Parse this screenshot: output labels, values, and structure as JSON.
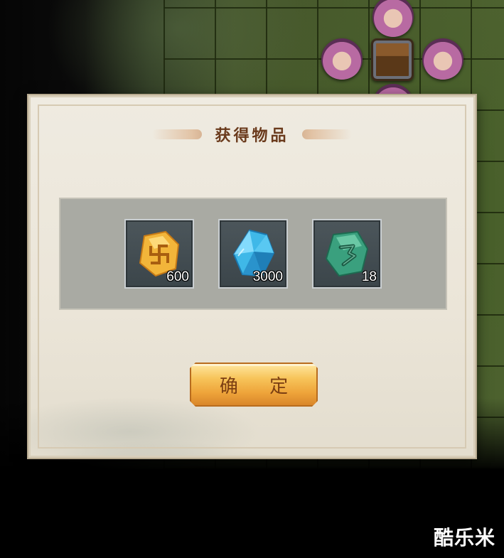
{
  "dialog": {
    "title": "获得物品",
    "confirm_label": "确 定"
  },
  "rewards": [
    {
      "icon": "gold-rune-stone-icon",
      "color": "#f2b53a",
      "count": "600"
    },
    {
      "icon": "blue-crystal-icon",
      "color": "#3fb8e8",
      "count": "3000"
    },
    {
      "icon": "green-jade-stone-icon",
      "color": "#3aa07e",
      "count": "18"
    }
  ],
  "watermark": "酷乐米"
}
